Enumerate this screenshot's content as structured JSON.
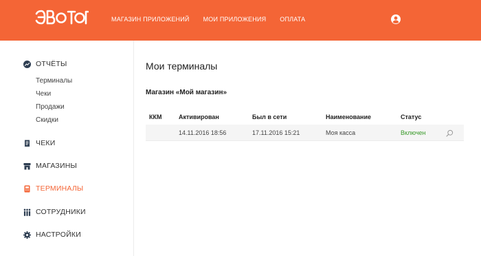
{
  "header": {
    "logo_text": "ЭВОТОР",
    "nav": [
      {
        "label": "МАГАЗИН ПРИЛОЖЕНИЙ"
      },
      {
        "label": "МОИ ПРИЛОЖЕНИЯ"
      },
      {
        "label": "ОПЛАТА"
      }
    ],
    "user_icon": "user-circle-icon"
  },
  "sidebar": {
    "reports": {
      "label": "ОТЧЁТЫ",
      "icon": "chart-icon"
    },
    "reports_sub": [
      {
        "label": "Терминалы"
      },
      {
        "label": "Чеки"
      },
      {
        "label": "Продажи"
      },
      {
        "label": "Скидки"
      }
    ],
    "items": [
      {
        "label": "ЧЕКИ",
        "icon": "receipt-icon"
      },
      {
        "label": "МАГАЗИНЫ",
        "icon": "store-icon"
      },
      {
        "label": "ТЕРМИНАЛЫ",
        "icon": "terminal-icon"
      },
      {
        "label": "СОТРУДНИКИ",
        "icon": "staff-icon"
      },
      {
        "label": "НАСТРОЙКИ",
        "icon": "gear-icon"
      }
    ],
    "active_item": "ТЕРМИНАЛЫ"
  },
  "main": {
    "title": "Мои терминалы",
    "store_title": "Магазин «Мой магазин»",
    "table": {
      "headers": [
        "ККМ",
        "Активирован",
        "Был в сети",
        "Наименование",
        "Статус"
      ],
      "rows": [
        {
          "kkm": "",
          "activated": "14.11.2016 18:56",
          "last_seen": "17.11.2016 15:21",
          "name": "Моя касса",
          "status": "Включен"
        }
      ]
    }
  },
  "colors": {
    "brand": "#f46536",
    "status_on": "#3a9a2a"
  }
}
